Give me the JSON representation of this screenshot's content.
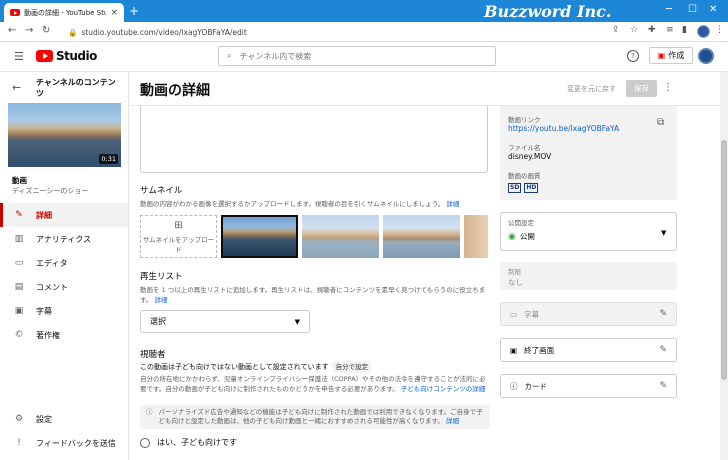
{
  "browser": {
    "tab_title": "動画の詳細 - YouTube Studio",
    "tab_close": "×",
    "new_tab": "+",
    "brand": "Buzzword Inc.",
    "url": "studio.youtube.com/video/lxagYOBFaYA/edit",
    "win_controls": [
      "─",
      "☐",
      "✕"
    ]
  },
  "header": {
    "logo_text": "Studio",
    "search_placeholder": "チャンネル内で検索",
    "help": "?",
    "create_label": "作成"
  },
  "sidebar": {
    "channel_title": "チャンネルのコンテンツ",
    "thumb_duration": "0:31",
    "video_label": "動画",
    "video_name": "ディズニーシーのショー",
    "items": [
      {
        "label": "詳細",
        "icon": "✎"
      },
      {
        "label": "アナリティクス",
        "icon": "▥"
      },
      {
        "label": "エディタ",
        "icon": "▭"
      },
      {
        "label": "コメント",
        "icon": "▤"
      },
      {
        "label": "字幕",
        "icon": "▣"
      },
      {
        "label": "著作権",
        "icon": "©"
      },
      {
        "label": "設定",
        "icon": "⚙"
      },
      {
        "label": "フィードバックを送信",
        "icon": "!"
      }
    ]
  },
  "page": {
    "title": "動画の詳細",
    "undo_label": "変更を元に戻す",
    "save_label": "保存",
    "more": "⋮"
  },
  "thumbnail": {
    "heading": "サムネイル",
    "desc": "動画の内容がわかる画像を選択するかアップロードします。視聴者の目を引くサムネイルにしましょう。",
    "desc_link": "詳細",
    "upload_label": "サムネイルをアップロード"
  },
  "playlist": {
    "heading": "再生リスト",
    "desc": "動画を 1 つ以上の再生リストに追加します。再生リストは、視聴者にコンテンツを素早く見つけてもらうのに役立ちます。",
    "desc_link": "詳細",
    "select_value": "選択"
  },
  "audience": {
    "heading": "視聴者",
    "status": "この動画は子ども向けではない動画として設定されています",
    "status_badge": "自分で設定",
    "desc": "自分の所在地にかかわらず、児童オンラインプライバシー保護法（COPPA）やその他の法令を遵守することが法的に必要です。自分の動画が子ども向けに制作されたものかどうかを申告する必要があります。",
    "desc_link": "子ども向けコンテンツの詳細",
    "note": "パーソナライズド広告や通知などの機能は子ども向けに制作された動画では利用できなくなります。ご自身で子ども向けと設定した動画は、他の子ども向け動画と一緒におすすめされる可能性が高くなります。",
    "note_link": "詳細",
    "radio_yes": "はい、子ども向けです"
  },
  "right": {
    "video_link_label": "動画リンク",
    "video_link": "https://youtu.be/lxagYOBFaYA",
    "filename_label": "ファイル名",
    "filename": "disney.MOV",
    "quality_label": "動画の画質",
    "quality_tags": [
      "SD",
      "HD"
    ],
    "visibility_label": "公開設定",
    "visibility_value": "公開",
    "restriction_label": "制限",
    "restriction_value": "なし",
    "cards": [
      {
        "label": "字幕",
        "icon": "▭",
        "disabled": true
      },
      {
        "label": "終了画面",
        "icon": "▣",
        "disabled": false
      },
      {
        "label": "カード",
        "icon": "ⓘ",
        "disabled": false
      }
    ]
  },
  "colors": {
    "accent": "#c00000",
    "link": "#065fd4",
    "titlebar": "#1d86d6"
  }
}
